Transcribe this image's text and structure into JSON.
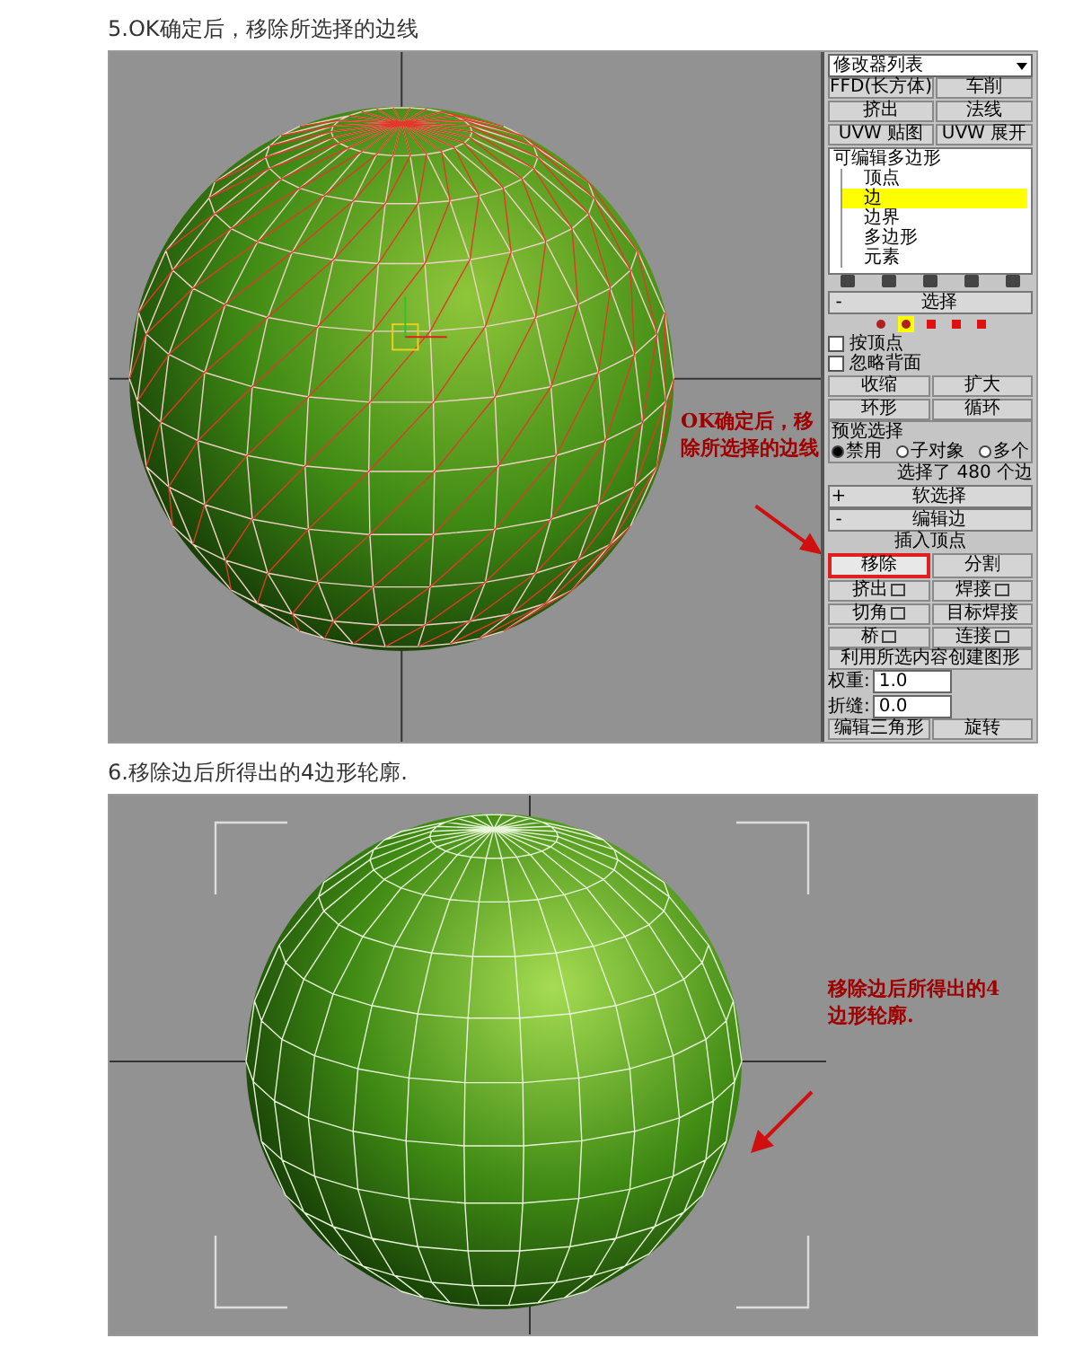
{
  "steps": [
    {
      "heading": "5.OK确定后，移除所选择的边线",
      "viewport": {
        "kind": "edges_selected",
        "annotation": "OK确定后，移除所选择的边线"
      },
      "panel": {
        "modifier_list": "修改器列表",
        "modifier_buttons": [
          "FFD(长方体)",
          "车削",
          "挤出",
          "法线",
          "UVW 贴图",
          "UVW 展开"
        ],
        "stack": {
          "label": "可编辑多边形",
          "children": [
            {
              "label": "顶点",
              "selected": false
            },
            {
              "label": "边",
              "selected": true
            },
            {
              "label": "边界",
              "selected": false
            },
            {
              "label": "多边形",
              "selected": false
            },
            {
              "label": "元素",
              "selected": false
            }
          ]
        },
        "selection": {
          "sign": "-",
          "title": "选择",
          "levels": [
            {
              "selected": false
            },
            {
              "selected": true
            },
            {
              "selected": false
            },
            {
              "selected": false
            },
            {
              "selected": false
            }
          ],
          "checkboxes": [
            {
              "label": "按顶点",
              "checked": false
            },
            {
              "label": "忽略背面",
              "checked": false
            }
          ],
          "buttons": [
            "收缩",
            "扩大",
            "环形",
            "循环"
          ],
          "preview": {
            "title": "预览选择",
            "options": [
              {
                "label": "禁用",
                "selected": true
              },
              {
                "label": "子对象",
                "selected": false
              },
              {
                "label": "多个",
                "selected": false
              }
            ]
          },
          "status": "选择了 480 个边"
        },
        "soft_selection": {
          "sign": "+",
          "title": "软选择"
        },
        "edit_edges": {
          "sign": "-",
          "title": "编辑边",
          "insert": "插入顶点",
          "buttons": [
            {
              "label": "移除",
              "highlighted": true,
              "settings": false
            },
            {
              "label": "分割",
              "highlighted": false,
              "settings": false
            },
            {
              "label": "挤出",
              "highlighted": false,
              "settings": true
            },
            {
              "label": "焊接",
              "highlighted": false,
              "settings": true
            },
            {
              "label": "切角",
              "highlighted": false,
              "settings": true
            },
            {
              "label": "目标焊接",
              "highlighted": false,
              "settings": false
            },
            {
              "label": "桥",
              "highlighted": false,
              "settings": true
            },
            {
              "label": "连接",
              "highlighted": false,
              "settings": true
            }
          ],
          "create_shape": "利用所选内容创建图形",
          "fields": [
            {
              "label": "权重:",
              "value": "1.0"
            },
            {
              "label": "折缝:",
              "value": "0.0"
            }
          ],
          "bottom_buttons": [
            "编辑三角形",
            "旋转"
          ]
        }
      }
    },
    {
      "heading": "6.移除边后所得出的4边形轮廓.",
      "viewport": {
        "kind": "quads",
        "annotation": "移除边后所得出的4边形轮廓."
      }
    }
  ]
}
